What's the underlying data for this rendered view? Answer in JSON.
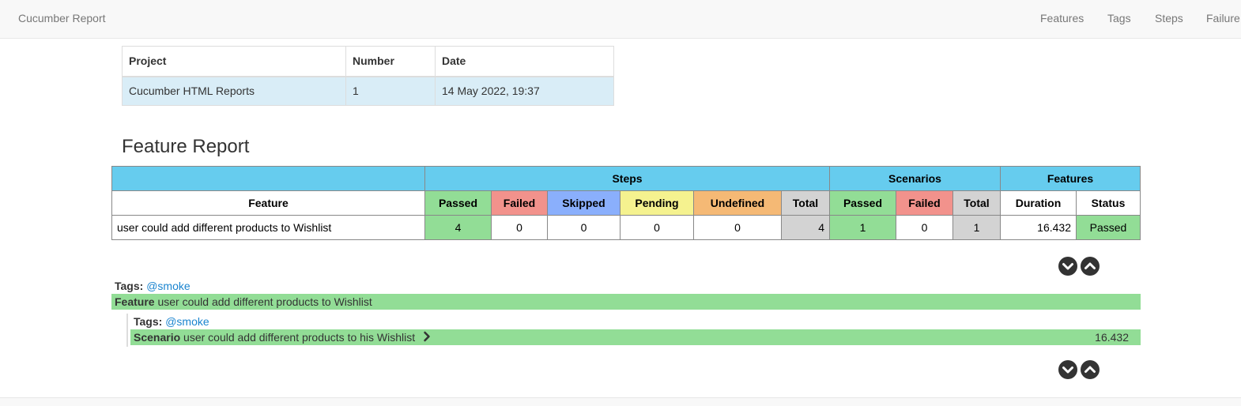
{
  "navbar": {
    "brand": "Cucumber Report",
    "links": [
      "Features",
      "Tags",
      "Steps",
      "Failure"
    ]
  },
  "build_info": {
    "headers": [
      "Project",
      "Number",
      "Date"
    ],
    "row": [
      "Cucumber HTML Reports",
      "1",
      "14 May 2022, 19:37"
    ]
  },
  "feature_report": {
    "title": "Feature Report",
    "group_headers": {
      "steps": "Steps",
      "scenarios": "Scenarios",
      "features": "Features"
    },
    "column_headers": {
      "feature": "Feature",
      "steps": [
        "Passed",
        "Failed",
        "Skipped",
        "Pending",
        "Undefined",
        "Total"
      ],
      "scenarios": [
        "Passed",
        "Failed",
        "Total"
      ],
      "features": [
        "Duration",
        "Status"
      ]
    },
    "row": {
      "feature": "user could add different products to Wishlist",
      "steps": [
        "4",
        "0",
        "0",
        "0",
        "0",
        "4"
      ],
      "scenarios": [
        "1",
        "0",
        "1"
      ],
      "duration": "16.432",
      "status": "Passed"
    }
  },
  "feature_section": {
    "tags_label": "Tags:",
    "tag": "@smoke",
    "keyword": "Feature",
    "name": "user could add different products to Wishlist",
    "scenario": {
      "tags_label": "Tags:",
      "tag": "@smoke",
      "keyword": "Scenario",
      "name": "user could add different products to his Wishlist",
      "duration": "16.432"
    }
  },
  "colors": {
    "passed": "#92dd96",
    "failed": "#f2928c",
    "skipped": "#8aaffc",
    "pending": "#f5f28f",
    "undefined": "#f5b975",
    "total": "#d3d3d3",
    "header": "#66ccee",
    "tag_link": "#1a84cf"
  },
  "icons": {
    "expand": "chevron-down-circle-icon",
    "collapse": "chevron-up-circle-icon",
    "scenario_toggle": "chevron-right-icon"
  }
}
